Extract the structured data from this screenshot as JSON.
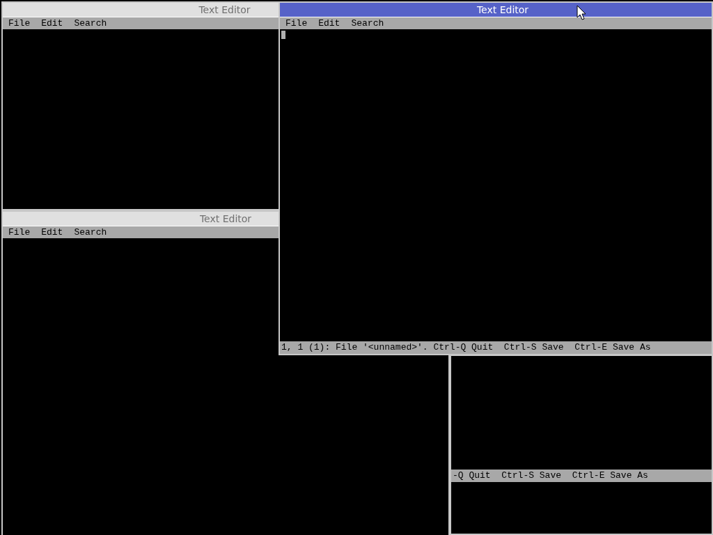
{
  "windows": [
    {
      "kind": "editor",
      "title": "Text Editor",
      "focused": false,
      "menu": [
        "File",
        "Edit",
        "Search"
      ]
    },
    {
      "kind": "editor",
      "title": "Text Editor",
      "focused": false,
      "menu": [
        "File",
        "Edit",
        "Search"
      ]
    },
    {
      "kind": "editor",
      "title": "Text Editor",
      "focused": true,
      "menu": [
        "File",
        "Edit",
        "Search"
      ],
      "status": "1, 1 (1): File '<unnamed>'. Ctrl-Q Quit  Ctrl-S Save  Ctrl-E Save As"
    },
    {
      "kind": "status_only",
      "status": "-Q Quit  Ctrl-S Save  Ctrl-E Save As"
    }
  ]
}
